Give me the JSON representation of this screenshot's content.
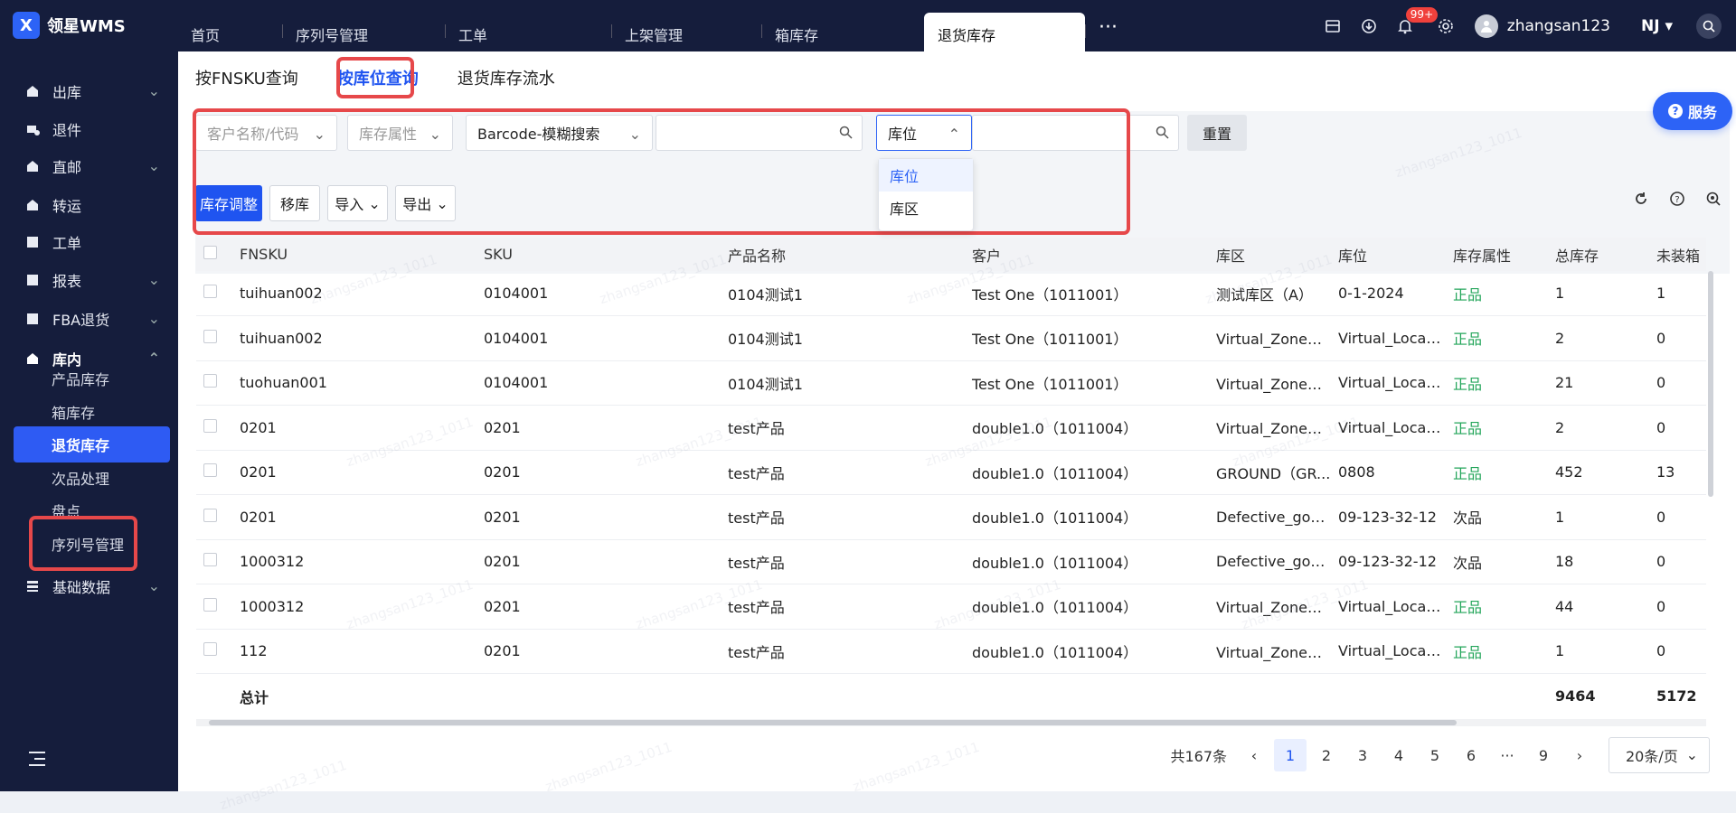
{
  "app": {
    "logo_text": "领星WMS",
    "logo_glyph": "X"
  },
  "top_tabs": [
    "首页",
    "序列号管理",
    "工单",
    "上架管理",
    "箱库存",
    "退货库存"
  ],
  "top_more": "···",
  "top_right": {
    "badge": "99+",
    "username": "zhangsan123",
    "company": "NJ"
  },
  "sidebar": {
    "menus": [
      {
        "label": "出库",
        "icon": "outbound-icon"
      },
      {
        "label": "退件",
        "icon": "return-icon"
      },
      {
        "label": "直邮",
        "icon": "direct-mail-icon"
      },
      {
        "label": "转运",
        "icon": "transfer-icon"
      },
      {
        "label": "工单",
        "icon": "work-order-icon"
      },
      {
        "label": "报表",
        "icon": "report-icon"
      },
      {
        "label": "FBA退货",
        "icon": "fba-icon"
      },
      {
        "label": "库内",
        "icon": "warehouse-icon"
      },
      {
        "label": "基础数据",
        "icon": "base-data-icon"
      }
    ],
    "sub_items": [
      "产品库存",
      "箱库存",
      "退货库存",
      "次品处理",
      "盘点",
      "序列号管理"
    ]
  },
  "sub_tabs": [
    "按FNSKU查询",
    "按库位查询",
    "退货库存流水"
  ],
  "filters": {
    "customer_placeholder": "客户名称/代码",
    "attr_placeholder": "库存属性",
    "barcode_mode": "Barcode-模糊搜索",
    "location_mode": "库位",
    "reset": "重置",
    "dropdown_options": [
      "库位",
      "库区"
    ]
  },
  "actions": {
    "adjust": "库存调整",
    "move": "移库",
    "import": "导入",
    "export": "导出"
  },
  "service_label": "服务",
  "table": {
    "headers": [
      "FNSKU",
      "SKU",
      "产品名称",
      "客户",
      "库区",
      "库位",
      "库存属性",
      "总库存",
      "未装箱"
    ],
    "rows": [
      [
        "tuihuan002",
        "0104001",
        "0104测试1",
        "Test One（1011001）",
        "测试库区（A）",
        "0-1-2024",
        "正品",
        "1",
        "1"
      ],
      [
        "tuihuan002",
        "0104001",
        "0104测试1",
        "Test One（1011001）",
        "Virtual_Zone（...",
        "Virtual_Location",
        "正品",
        "2",
        "0"
      ],
      [
        "tuohuan001",
        "0104001",
        "0104测试1",
        "Test One（1011001）",
        "Virtual_Zone（...",
        "Virtual_Location",
        "正品",
        "21",
        "0"
      ],
      [
        "0201",
        "0201",
        "test产品",
        "double1.0（1011004）",
        "Virtual_Zone（...",
        "Virtual_Location",
        "正品",
        "2",
        "0"
      ],
      [
        "0201",
        "0201",
        "test产品",
        "double1.0（1011004）",
        "GROUND（GR...",
        "0808",
        "正品",
        "452",
        "13"
      ],
      [
        "0201",
        "0201",
        "test产品",
        "double1.0（1011004）",
        "Defective_goo...",
        "09-123-32-12",
        "次品",
        "1",
        "0"
      ],
      [
        "1000312",
        "0201",
        "test产品",
        "double1.0（1011004）",
        "Defective_goo...",
        "09-123-32-12",
        "次品",
        "18",
        "0"
      ],
      [
        "1000312",
        "0201",
        "test产品",
        "double1.0（1011004）",
        "Virtual_Zone（...",
        "Virtual_Location",
        "正品",
        "44",
        "0"
      ],
      [
        "112",
        "0201",
        "test产品",
        "double1.0（1011004）",
        "Virtual_Zone（...",
        "Virtual_Location",
        "正品",
        "1",
        "0"
      ]
    ],
    "total_label": "总计",
    "total_stock": "9464",
    "total_unboxed": "5172"
  },
  "pager": {
    "total": "共167条",
    "pages": [
      "1",
      "2",
      "3",
      "4",
      "5",
      "6",
      "···",
      "9"
    ],
    "current": "1",
    "size": "20条/页"
  },
  "watermark": "zhangsan123_1011",
  "colors": {
    "primary": "#1f54f0",
    "sidebar": "#151d3c",
    "good": "#23a55a",
    "highlight": "#e6484a"
  }
}
